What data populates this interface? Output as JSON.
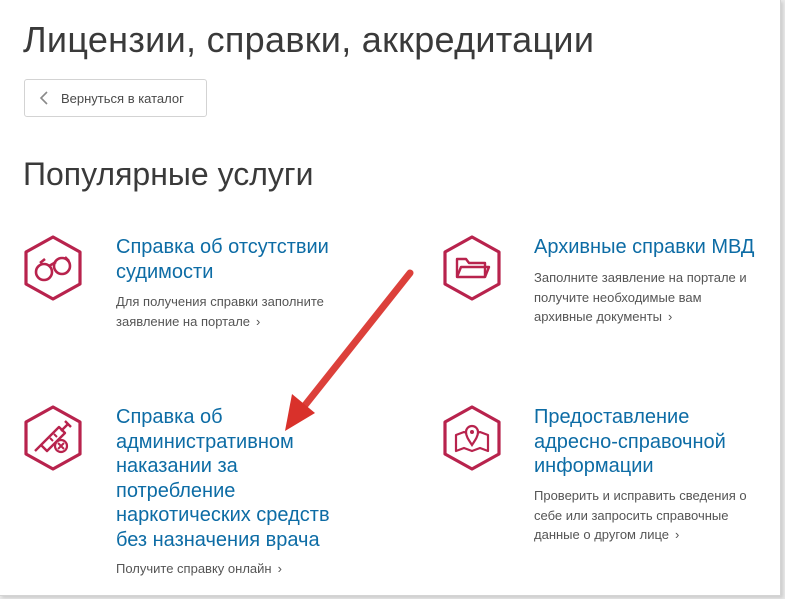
{
  "page_title": "Лицензии, справки, аккредитации",
  "back_button": {
    "label": "Вернуться в каталог"
  },
  "section_title": "Популярные услуги",
  "colors": {
    "accent_icon": "#b8234d",
    "link": "#0d6ca5",
    "arrow": "#d9312b"
  },
  "services": [
    {
      "title": "Справка об отсутствии судимости",
      "desc_lines": [
        "Для получения справки заполните",
        "заявление на портале"
      ],
      "icon": "handcuffs-icon"
    },
    {
      "title": "Архивные справки МВД",
      "desc_lines": [
        "Заполните заявление на портале и",
        "получите необходимые вам",
        "архивные документы"
      ],
      "icon": "folder-icon"
    },
    {
      "title": "Справка об административном наказании за потребление наркотических средств без назначения врача",
      "title_lines": [
        "Справка об",
        "административном",
        "наказании за",
        "потребление",
        "наркотических средств",
        "без назначения врача"
      ],
      "desc_lines": [
        "Получите справку онлайн"
      ],
      "icon": "syringe-icon"
    },
    {
      "title": "Предоставление адресно-справочной информации",
      "title_lines": [
        "Предоставление",
        "адресно-справочной",
        "информации"
      ],
      "desc_lines": [
        "Проверить и исправить сведения о",
        "себе или запросить справочные",
        "данные о другом лице"
      ],
      "icon": "map-pin-icon"
    }
  ]
}
